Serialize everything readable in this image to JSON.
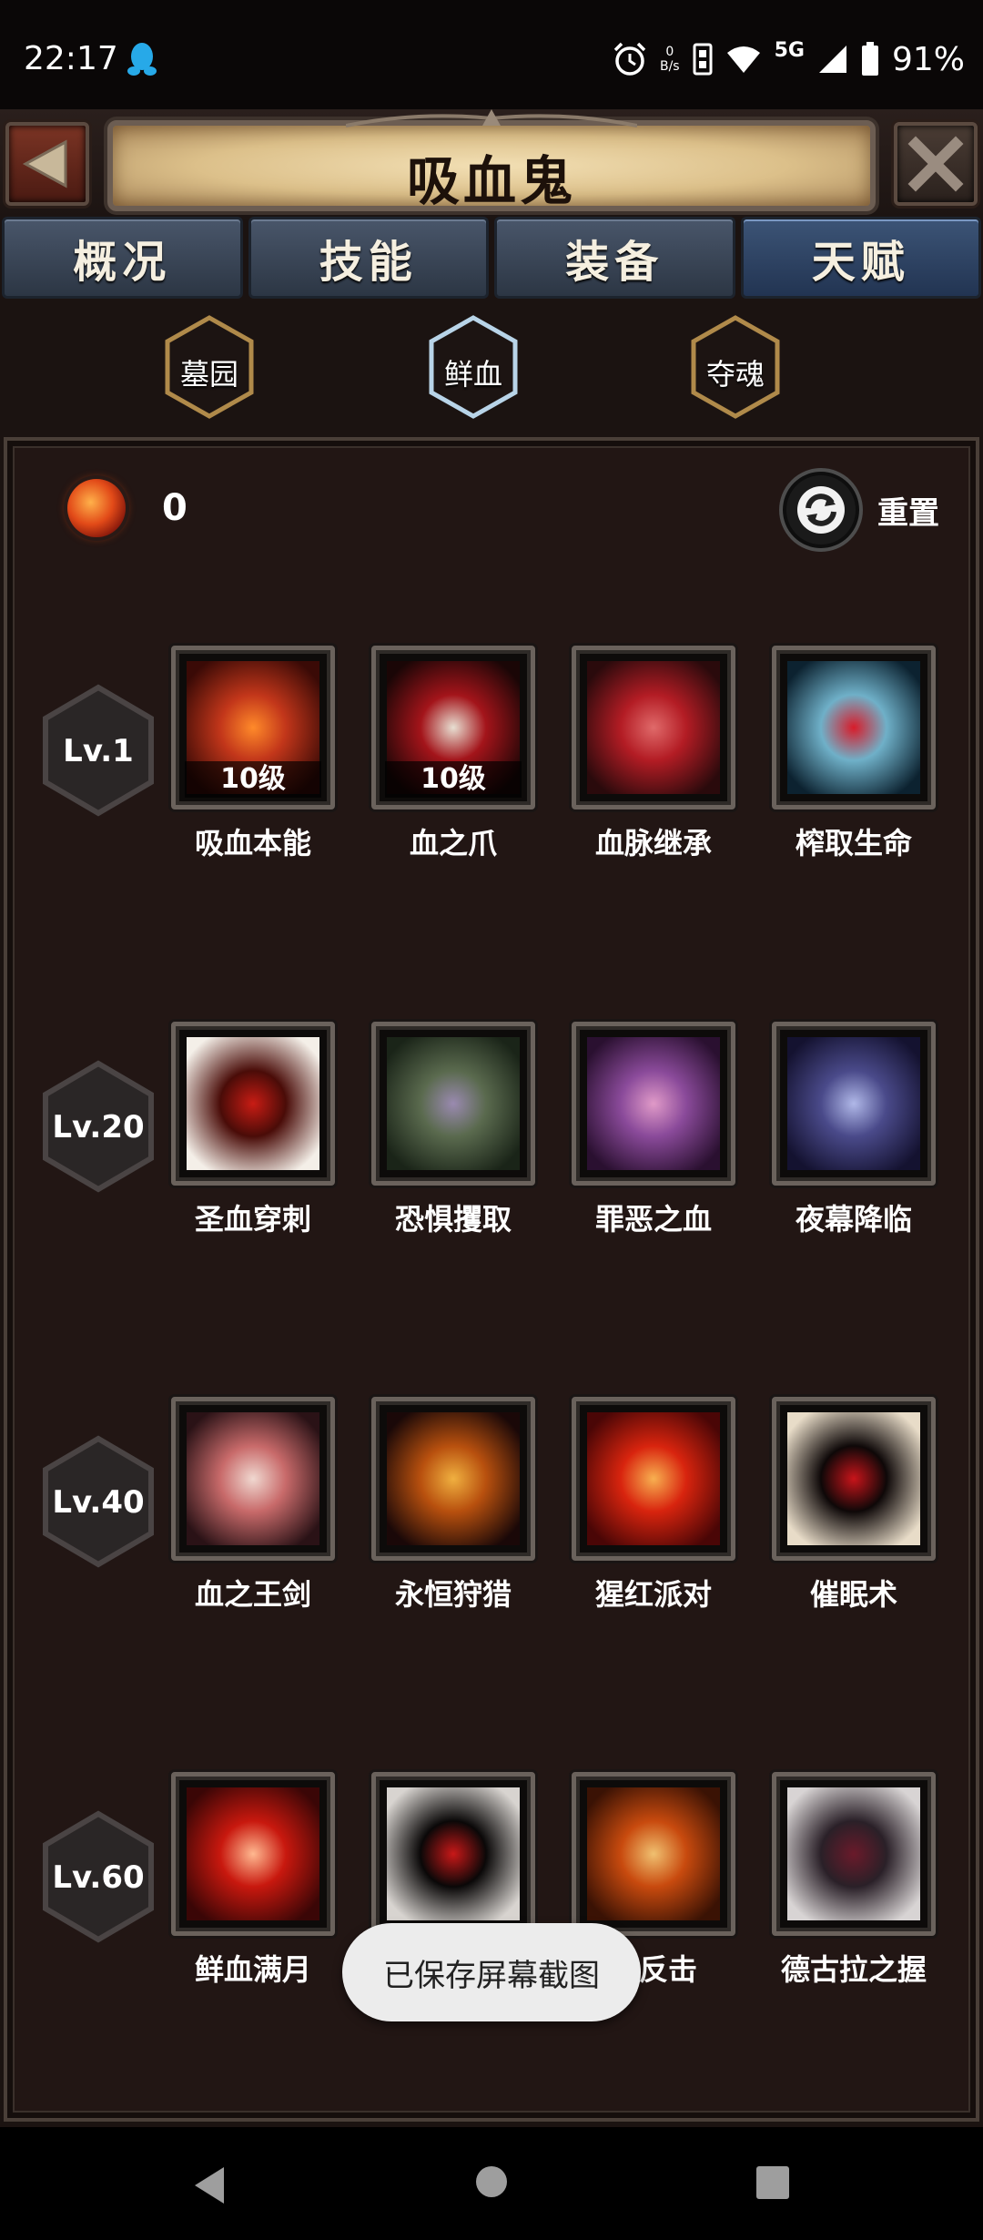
{
  "status_bar": {
    "time": "22:17",
    "net_speed_value": "0",
    "net_speed_unit": "B/s",
    "network": "5G",
    "battery": "91%",
    "icons": [
      "qq-icon",
      "alarm-icon",
      "data-saver-icon",
      "wifi-icon",
      "signal-icon",
      "battery-icon"
    ]
  },
  "header": {
    "title": "吸血鬼",
    "back_icon": "triangle-left-icon",
    "close_icon": "close-x-icon"
  },
  "tabs": [
    {
      "label": "概况",
      "active": false
    },
    {
      "label": "技能",
      "active": false
    },
    {
      "label": "装备",
      "active": false
    },
    {
      "label": "天赋",
      "active": true
    }
  ],
  "sub_tabs": [
    {
      "label": "墓园",
      "active": false
    },
    {
      "label": "鲜血",
      "active": true
    },
    {
      "label": "夺魂",
      "active": false
    }
  ],
  "points": {
    "value": "0",
    "icon": "blood-orb-icon"
  },
  "reset": {
    "label": "重置",
    "icon": "refresh-icon"
  },
  "rows": [
    {
      "level": "Lv.1",
      "skills": [
        {
          "name": "吸血本能",
          "level": "10级",
          "colors": [
            "#3a0a06",
            "#c2361a",
            "#ff8a2a"
          ]
        },
        {
          "name": "血之爪",
          "level": "10级",
          "colors": [
            "#1a0606",
            "#a3141a",
            "#e8dfd2"
          ]
        },
        {
          "name": "血脉继承",
          "level": "",
          "colors": [
            "#2a0a0c",
            "#b31c24",
            "#e06a6a"
          ]
        },
        {
          "name": "榨取生命",
          "level": "",
          "colors": [
            "#0c2230",
            "#6fb0c8",
            "#d81c2a"
          ]
        }
      ]
    },
    {
      "level": "Lv.20",
      "skills": [
        {
          "name": "圣血穿刺",
          "level": "",
          "colors": [
            "#f4efe8",
            "#4a0c08",
            "#c81c14"
          ]
        },
        {
          "name": "恐惧攫取",
          "level": "",
          "colors": [
            "#1a2418",
            "#5a6a4e",
            "#9a8ab0"
          ]
        },
        {
          "name": "罪恶之血",
          "level": "",
          "colors": [
            "#2a1030",
            "#8a4a9a",
            "#e09ac8"
          ]
        },
        {
          "name": "夜幕降临",
          "level": "",
          "colors": [
            "#141230",
            "#4a4a8a",
            "#b0b8e8"
          ]
        }
      ]
    },
    {
      "level": "Lv.40",
      "skills": [
        {
          "name": "血之王剑",
          "level": "",
          "colors": [
            "#2a1216",
            "#c86a6a",
            "#f0d8d0"
          ]
        },
        {
          "name": "永恒狩猎",
          "level": "",
          "colors": [
            "#1a0808",
            "#b8500e",
            "#f0b040"
          ]
        },
        {
          "name": "猩红派对",
          "level": "",
          "colors": [
            "#4a0606",
            "#d8240e",
            "#f8b050"
          ]
        },
        {
          "name": "催眠术",
          "level": "",
          "colors": [
            "#e8dcc8",
            "#0e0808",
            "#c8141a"
          ]
        }
      ]
    },
    {
      "level": "Lv.60",
      "skills": [
        {
          "name": "鲜血满月",
          "level": "",
          "colors": [
            "#3a0606",
            "#c8180e",
            "#ffb890"
          ]
        },
        {
          "name": "",
          "level": "",
          "colors": [
            "#d8d4d0",
            "#0a0808",
            "#c81818"
          ]
        },
        {
          "name": "血反击",
          "level": "",
          "colors": [
            "#3a1204",
            "#c84a0e",
            "#f0c070"
          ]
        },
        {
          "name": "德古拉之握",
          "level": "",
          "colors": [
            "#d8d4d4",
            "#2a2028",
            "#6a1a2a"
          ]
        }
      ]
    }
  ],
  "toast": {
    "text": "已保存屏幕截图"
  },
  "nav_bar": {
    "icons": [
      "back-triangle-icon",
      "home-circle-icon",
      "recents-square-icon"
    ]
  }
}
